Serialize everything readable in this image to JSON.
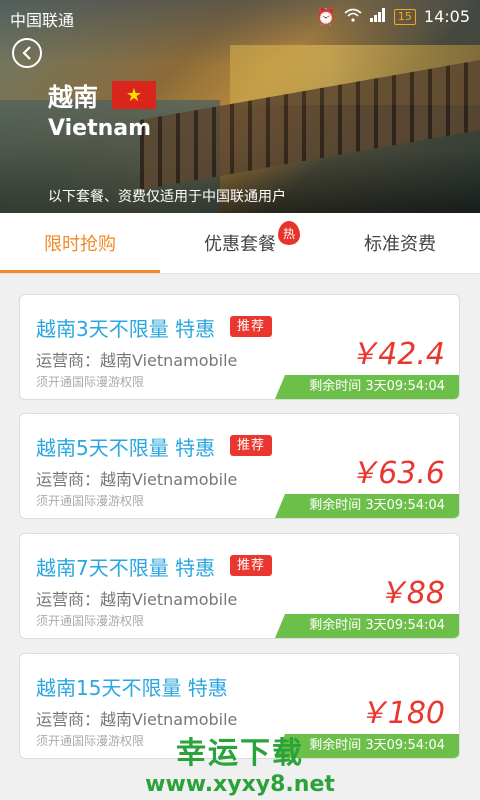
{
  "status_bar": {
    "carrier": "中国联通",
    "battery": "15",
    "time": "14:05"
  },
  "hero": {
    "country_cn": "越南",
    "country_en": "Vietnam",
    "notice": "以下套餐、资费仅适用于中国联通用户"
  },
  "tabs": [
    {
      "label": "限时抢购",
      "active": true
    },
    {
      "label": "优惠套餐",
      "badge": "热"
    },
    {
      "label": "标准资费"
    }
  ],
  "cards": [
    {
      "title": "越南3天不限量 特惠",
      "tag": "推荐",
      "operator": "运营商：越南Vietnamobile",
      "requirement": "须开通国际漫游权限",
      "price": "￥42.4",
      "timer": "剩余时间 3天09:54:04"
    },
    {
      "title": "越南5天不限量 特惠",
      "tag": "推荐",
      "operator": "运营商：越南Vietnamobile",
      "requirement": "须开通国际漫游权限",
      "price": "￥63.6",
      "timer": "剩余时间 3天09:54:04"
    },
    {
      "title": "越南7天不限量 特惠",
      "tag": "推荐",
      "operator": "运营商：越南Vietnamobile",
      "requirement": "须开通国际漫游权限",
      "price": "￥88",
      "timer": "剩余时间 3天09:54:04"
    },
    {
      "title": "越南15天不限量 特惠",
      "operator": "运营商：越南Vietnamobile",
      "requirement": "须开通国际漫游权限",
      "price": "￥180",
      "timer": "剩余时间 3天09:54:04"
    }
  ],
  "watermark": {
    "cn": "幸运下载",
    "url": "www.xyxy8.net"
  },
  "colors": {
    "accent": "#f08a2c",
    "title_blue": "#2aa7e0",
    "price_red": "#e9372f",
    "timer_green": "#6cc04a"
  }
}
